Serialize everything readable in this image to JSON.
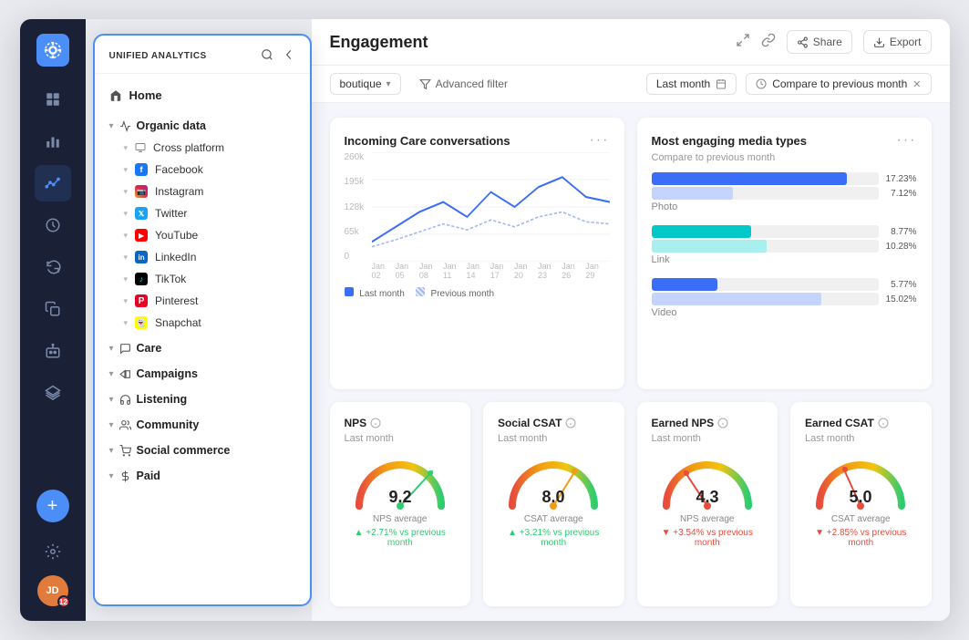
{
  "app": {
    "name": "UNIFIED ANALYTICS",
    "title": "gement",
    "full_title": "Engagement"
  },
  "header": {
    "share_label": "Share",
    "export_label": "Export"
  },
  "filters": {
    "boutique_label": "boutique",
    "advanced_filter_label": "Advanced filter",
    "date_label": "Last month",
    "compare_label": "Compare to previous month"
  },
  "sidebar": {
    "home_label": "Home",
    "sections": [
      {
        "id": "organic-data",
        "label": "Organic data",
        "icon": "📊",
        "expanded": true,
        "children": [
          {
            "id": "cross-platform",
            "label": "Cross platform",
            "icon": "🔗"
          },
          {
            "id": "facebook",
            "label": "Facebook",
            "icon": "f",
            "color": "#1877F2"
          },
          {
            "id": "instagram",
            "label": "Instagram",
            "icon": "ig",
            "color": "#E1306C"
          },
          {
            "id": "twitter",
            "label": "Twitter",
            "icon": "t",
            "color": "#1DA1F2"
          },
          {
            "id": "youtube",
            "label": "YouTube",
            "icon": "yt",
            "color": "#FF0000"
          },
          {
            "id": "linkedin",
            "label": "LinkedIn",
            "icon": "in",
            "color": "#0A66C2"
          },
          {
            "id": "tiktok",
            "label": "TikTok",
            "icon": "tk",
            "color": "#000"
          },
          {
            "id": "pinterest",
            "label": "Pinterest",
            "icon": "p",
            "color": "#E60023"
          },
          {
            "id": "snapchat",
            "label": "Snapchat",
            "icon": "sc",
            "color": "#FFFC00"
          }
        ]
      },
      {
        "id": "care",
        "label": "Care",
        "icon": "💬",
        "expanded": false,
        "children": []
      },
      {
        "id": "campaigns",
        "label": "Campaigns",
        "icon": "📢",
        "expanded": false,
        "children": []
      },
      {
        "id": "listening",
        "label": "Listening",
        "icon": "🎧",
        "expanded": false,
        "children": []
      },
      {
        "id": "community",
        "label": "Community",
        "icon": "👥",
        "expanded": false,
        "children": []
      },
      {
        "id": "social-commerce",
        "label": "Social commerce",
        "icon": "🛒",
        "expanded": false,
        "children": []
      },
      {
        "id": "paid",
        "label": "Paid",
        "icon": "💰",
        "expanded": false,
        "children": []
      }
    ]
  },
  "cards": {
    "line_chart": {
      "title": "Incoming Care conversations",
      "subtitle": "",
      "y_labels": [
        "260k",
        "195k",
        "128k",
        "65k",
        "0"
      ],
      "x_labels": [
        "Jan 02",
        "Jan 05",
        "Jan 08",
        "Jan 11",
        "Jan 14",
        "Jan 17",
        "Jan 20",
        "Jan 23",
        "Jan 26",
        "Jan 29"
      ],
      "legend": [
        "Last month",
        "Previous month"
      ]
    },
    "bar_chart": {
      "title": "Most engaging media types",
      "subtitle": "Compare to previous month",
      "bars": [
        {
          "label": "Photo",
          "current_pct": 17.23,
          "prev_pct": 7.12,
          "color": "#3b6ef7",
          "prev_color": "#a0b8f8"
        },
        {
          "label": "Link",
          "current_pct": 8.77,
          "prev_pct": 10.28,
          "color": "#00c9c9",
          "prev_color": "#7eeaea"
        },
        {
          "label": "Video",
          "current_pct": 5.77,
          "prev_pct": 15.02,
          "color": "#3b6ef7",
          "prev_color": "#a0b8f8"
        }
      ],
      "max_pct": 20
    },
    "gauges": [
      {
        "id": "nps",
        "title": "NPS",
        "has_info": true,
        "subtitle": "Last month",
        "value": "9.2",
        "needle_color": "#2ecc71",
        "label": "NPS average",
        "trend": "+2.71%",
        "trend_dir": "up",
        "trend_text": "vs previous month",
        "arc_colors": [
          "#e74c3c",
          "#f39c12",
          "#f1c40f",
          "#2ecc71"
        ]
      },
      {
        "id": "social-csat",
        "title": "Social CSAT",
        "has_info": true,
        "subtitle": "Last month",
        "value": "8.0",
        "needle_color": "#f39c12",
        "label": "CSAT average",
        "trend": "+3.21%",
        "trend_dir": "up",
        "trend_text": "vs previous month",
        "arc_colors": [
          "#e74c3c",
          "#f39c12",
          "#f1c40f",
          "#2ecc71"
        ]
      },
      {
        "id": "earned-nps",
        "title": "Earned NPS",
        "has_info": true,
        "subtitle": "Last month",
        "value": "4.3",
        "needle_color": "#e74c3c",
        "label": "NPS average",
        "trend": "+3.54%",
        "trend_dir": "down",
        "trend_text": "vs previous month",
        "arc_colors": [
          "#e74c3c",
          "#f39c12",
          "#f1c40f",
          "#2ecc71"
        ]
      },
      {
        "id": "earned-csat",
        "title": "Earned CSAT",
        "has_info": true,
        "subtitle": "Last month",
        "value": "5.0",
        "needle_color": "#e74c3c",
        "label": "CSAT average",
        "trend": "+2.85%",
        "trend_dir": "down",
        "trend_text": "vs previous month",
        "arc_colors": [
          "#e74c3c",
          "#f39c12",
          "#f1c40f",
          "#2ecc71"
        ]
      }
    ]
  },
  "rail": {
    "icons": [
      "grid",
      "bar-chart",
      "line-chart",
      "clock",
      "refresh",
      "copy",
      "bot",
      "layers"
    ],
    "avatar_initials": "JD",
    "badge_count": "12"
  }
}
